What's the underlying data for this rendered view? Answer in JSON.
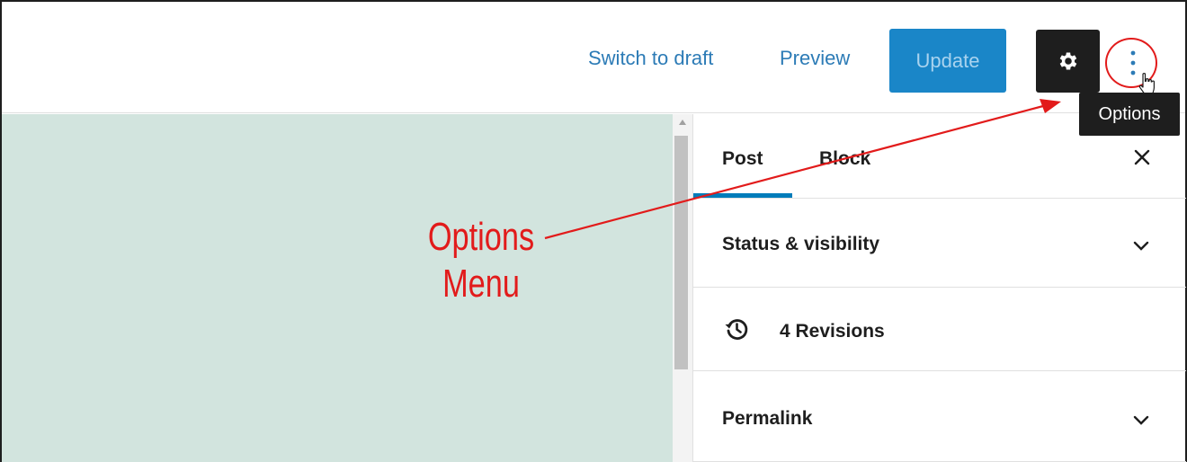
{
  "header": {
    "switch_to_draft_label": "Switch to draft",
    "preview_label": "Preview",
    "update_label": "Update",
    "settings_icon": "gear-icon",
    "options_icon": "vertical-ellipsis-icon",
    "tooltip": "Options"
  },
  "sidebar": {
    "tabs": [
      {
        "label": "Post",
        "active": true
      },
      {
        "label": "Block",
        "active": false
      }
    ],
    "close_icon": "close-icon",
    "panels": [
      {
        "title": "Status & visibility",
        "icon": "chevron-down-icon"
      },
      {
        "title": "4 Revisions",
        "icon": "history-icon"
      },
      {
        "title": "Permalink",
        "icon": "chevron-down-icon"
      }
    ]
  },
  "annotation": {
    "line1": "Options",
    "line2": "Menu"
  },
  "colors": {
    "accent": "#007cba",
    "update_bg": "#1a86c8",
    "annotation_red": "#e21b1b",
    "canvas_bg": "#d2e4de"
  }
}
